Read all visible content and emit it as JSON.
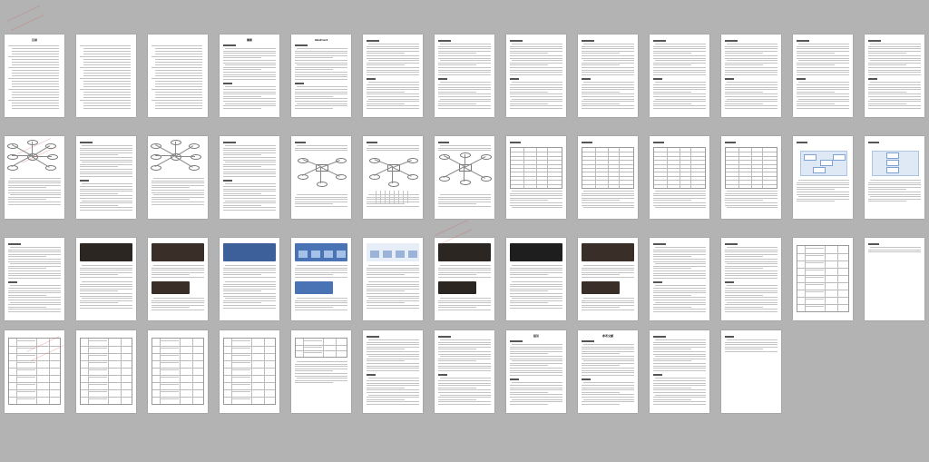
{
  "viewer": {
    "rows": [
      {
        "pages": [
          {
            "kind": "toc",
            "title": "目录"
          },
          {
            "kind": "toc"
          },
          {
            "kind": "toc"
          },
          {
            "kind": "text",
            "title": "摘要"
          },
          {
            "kind": "text",
            "title": "Abstract"
          },
          {
            "kind": "text"
          },
          {
            "kind": "text"
          },
          {
            "kind": "text"
          },
          {
            "kind": "text"
          },
          {
            "kind": "text"
          },
          {
            "kind": "text"
          },
          {
            "kind": "text"
          },
          {
            "kind": "text"
          }
        ]
      },
      {
        "pages": [
          {
            "kind": "mindmap"
          },
          {
            "kind": "text"
          },
          {
            "kind": "mindmap"
          },
          {
            "kind": "text"
          },
          {
            "kind": "er"
          },
          {
            "kind": "er2"
          },
          {
            "kind": "er3"
          },
          {
            "kind": "table"
          },
          {
            "kind": "table"
          },
          {
            "kind": "table"
          },
          {
            "kind": "table"
          },
          {
            "kind": "flow"
          },
          {
            "kind": "flow2"
          }
        ]
      },
      {
        "pages": [
          {
            "kind": "text"
          },
          {
            "kind": "shot",
            "img": "dark"
          },
          {
            "kind": "shot",
            "img": "dark2"
          },
          {
            "kind": "shot",
            "img": "blue"
          },
          {
            "kind": "shot",
            "img": "grid"
          },
          {
            "kind": "shot",
            "img": "grid2"
          },
          {
            "kind": "shot",
            "img": "dark"
          },
          {
            "kind": "shot",
            "img": "dark3"
          },
          {
            "kind": "shot",
            "img": "dark2"
          },
          {
            "kind": "text"
          },
          {
            "kind": "text"
          },
          {
            "kind": "table2"
          },
          {
            "kind": "blank"
          }
        ]
      },
      {
        "pages": [
          {
            "kind": "table2"
          },
          {
            "kind": "table2"
          },
          {
            "kind": "table2"
          },
          {
            "kind": "table2"
          },
          {
            "kind": "table3"
          },
          {
            "kind": "text"
          },
          {
            "kind": "text"
          },
          {
            "kind": "text",
            "title": "结论"
          },
          {
            "kind": "text",
            "title": "参考文献"
          },
          {
            "kind": "text"
          },
          {
            "kind": "short"
          }
        ]
      }
    ],
    "colors": {
      "background": "#b3b3b3",
      "page": "#ffffff",
      "shot_dark": "#2b2622",
      "shot_blue": "#3d5f9a",
      "shot_grid": "#4a73b5"
    }
  }
}
